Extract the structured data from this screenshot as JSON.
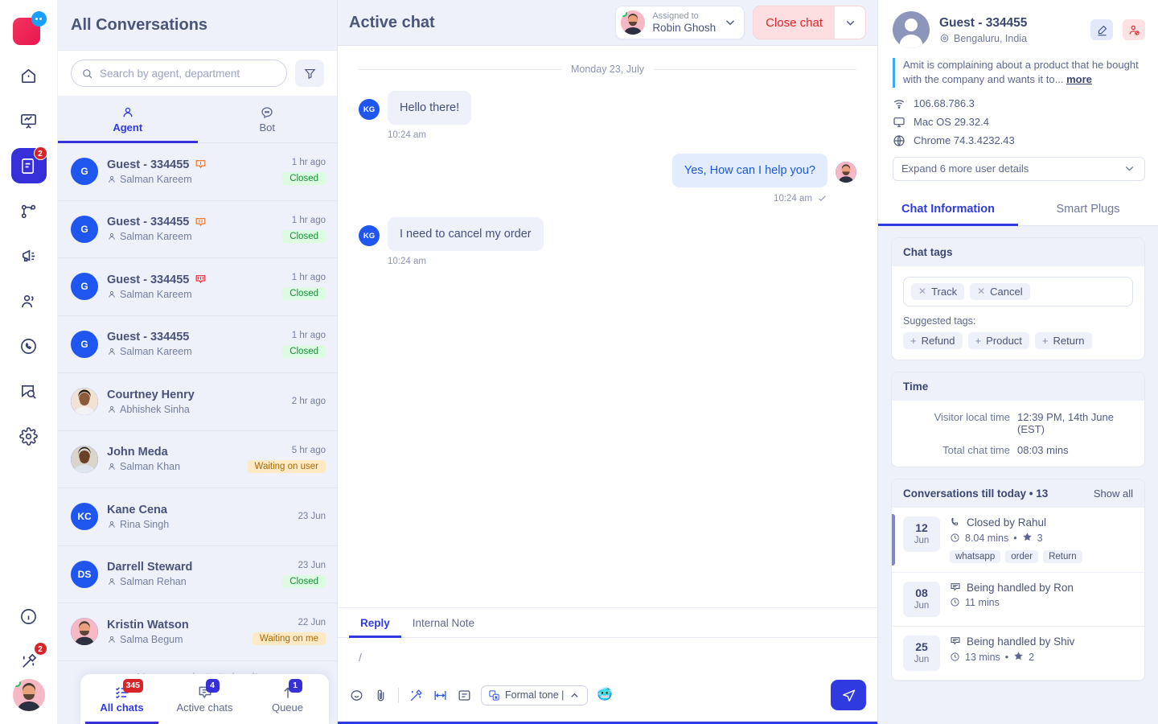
{
  "rail": {
    "logo": "brand-logo",
    "items": [
      {
        "name": "home-icon",
        "badge": null
      },
      {
        "name": "analytics-icon",
        "badge": null
      },
      {
        "name": "conversations-icon",
        "badge": "2",
        "active": true
      },
      {
        "name": "flows-icon",
        "badge": null
      },
      {
        "name": "campaigns-icon",
        "badge": null
      },
      {
        "name": "contacts-icon",
        "badge": null
      },
      {
        "name": "whatsapp-icon",
        "badge": null
      },
      {
        "name": "search-chat-icon",
        "badge": null
      },
      {
        "name": "settings-icon",
        "badge": null
      },
      {
        "name": "info-icon",
        "badge": null
      },
      {
        "name": "magic-icon",
        "badge": "2"
      }
    ]
  },
  "list": {
    "title": "All Conversations",
    "search_placeholder": "Search by agent, department",
    "search_value": "",
    "filter_label": "filter-icon",
    "tabs": [
      {
        "label": "Agent",
        "icon": "agent-icon",
        "active": true
      },
      {
        "label": "Bot",
        "icon": "bot-icon",
        "active": false
      }
    ],
    "no_more_text": "No more chats to load!",
    "conversations": [
      {
        "name": "Guest - 334455",
        "agent": "Salman Kareem",
        "time": "1 hr ago",
        "status": "Closed",
        "status_kind": "closed",
        "avatar": "G",
        "avatar_kind": "initial",
        "priority": 1
      },
      {
        "name": "Guest - 334455",
        "agent": "Salman Kareem",
        "time": "1 hr ago",
        "status": "Closed",
        "status_kind": "closed",
        "avatar": "G",
        "avatar_kind": "initial",
        "priority": 2
      },
      {
        "name": "Guest - 334455",
        "agent": "Salman Kareem",
        "time": "1 hr ago",
        "status": "Closed",
        "status_kind": "closed",
        "avatar": "G",
        "avatar_kind": "initial",
        "priority": 3
      },
      {
        "name": "Guest - 334455",
        "agent": "Salman Kareem",
        "time": "1 hr ago",
        "status": "Closed",
        "status_kind": "closed",
        "avatar": "G",
        "avatar_kind": "initial",
        "priority": 0
      },
      {
        "name": "Courtney Henry",
        "agent": "Abhishek Sinha",
        "time": "2 hr ago",
        "status": "",
        "status_kind": "none",
        "avatar": "",
        "avatar_kind": "photo-a",
        "priority": 0
      },
      {
        "name": "John Meda",
        "agent": "Salman Khan",
        "time": "5 hr ago",
        "status": "Waiting on user",
        "status_kind": "waituser",
        "avatar": "",
        "avatar_kind": "photo-b",
        "priority": 0
      },
      {
        "name": "Kane Cena",
        "agent": "Rina Singh",
        "time": "23 Jun",
        "status": "",
        "status_kind": "none",
        "avatar": "KC",
        "avatar_kind": "initial",
        "priority": 0
      },
      {
        "name": "Darrell Steward",
        "agent": "Salman Rehan",
        "time": "23 Jun",
        "status": "Closed",
        "status_kind": "closed",
        "avatar": "DS",
        "avatar_kind": "initial",
        "priority": 0
      },
      {
        "name": "Kristin Watson",
        "agent": "Salma Begum",
        "time": "22 Jun",
        "status": "Waiting on me",
        "status_kind": "waitme",
        "avatar": "",
        "avatar_kind": "photo-c",
        "priority": 0
      }
    ],
    "bottom_nav": [
      {
        "label": "All chats",
        "badge": "345",
        "badge_color": "red",
        "icon": "all-chats-icon",
        "active": true
      },
      {
        "label": "Active chats",
        "badge": "4",
        "badge_color": "blue",
        "icon": "active-chats-icon",
        "active": false
      },
      {
        "label": "Queue",
        "badge": "1",
        "badge_color": "blue",
        "icon": "queue-arrow-icon",
        "active": false
      }
    ]
  },
  "chat": {
    "title": "Active chat",
    "assigned_label": "Assigned to",
    "assigned_name": "Robin Ghosh",
    "close_button": "Close chat",
    "date_separator": "Monday 23, July",
    "messages": [
      {
        "dir": "in",
        "avatar": "KG",
        "text": "Hello there!",
        "time": "10:24 am",
        "read": false
      },
      {
        "dir": "out",
        "avatar": "",
        "text": "Yes, How can I help you?",
        "time": "10:24 am",
        "read": true
      },
      {
        "dir": "in",
        "avatar": "KG",
        "text": "I need to cancel my order",
        "time": "10:24 am",
        "read": false
      }
    ],
    "composer": {
      "tabs": [
        {
          "label": "Reply",
          "active": true
        },
        {
          "label": "Internal Note",
          "active": false
        }
      ],
      "value": "/",
      "tools": [
        {
          "name": "emoji-icon"
        },
        {
          "name": "attachment-icon"
        },
        {
          "name": "magic-wand-icon"
        },
        {
          "name": "expand-width-icon"
        },
        {
          "name": "canned-response-icon"
        }
      ],
      "tone_label": "Formal tone |",
      "tone_emoji": "🥶",
      "send_label": "send-icon"
    }
  },
  "panel": {
    "user": {
      "name": "Guest - 334455",
      "location": "Bengaluru, India",
      "note": "Amit is complaining about a product that he bought with the company and wants it to...",
      "note_more": "more",
      "meta": [
        {
          "icon": "wifi-icon",
          "value": "106.68.786.3"
        },
        {
          "icon": "desktop-icon",
          "value": "Mac OS 29.32.4"
        },
        {
          "icon": "globe-icon",
          "value": "Chrome 74.3.4232.43"
        }
      ],
      "expand_label": "Expand 6 more user details",
      "edit_icon": "edit-pencil-icon",
      "block_icon": "block-user-icon"
    },
    "tabs": [
      {
        "label": "Chat Information",
        "active": true
      },
      {
        "label": "Smart Plugs",
        "active": false
      }
    ],
    "chat_tags": {
      "title": "Chat tags",
      "tags": [
        "Track",
        "Cancel"
      ],
      "suggested_label": "Suggested tags:",
      "suggested": [
        "Refund",
        "Product",
        "Return"
      ]
    },
    "time": {
      "title": "Time",
      "rows": [
        {
          "label": "Visitor local time",
          "value": "12:39 PM, 14th June (EST)"
        },
        {
          "label": "Total chat time",
          "value": "08:03 mins"
        }
      ]
    },
    "history": {
      "title": "Conversations till today • 13",
      "show_all": "Show all",
      "items": [
        {
          "day": "12",
          "month": "Jun",
          "title": "Closed by Rahul",
          "title_icon": "phone-icon",
          "duration": "8.04 mins",
          "rating": "3",
          "tags": [
            "whatsapp",
            "order",
            "Return"
          ],
          "active": true
        },
        {
          "day": "08",
          "month": "Jun",
          "title": "Being handled by Ron",
          "title_icon": "chat-icon",
          "duration": "11 mins",
          "rating": "",
          "tags": [],
          "active": false
        },
        {
          "day": "25",
          "month": "Jun",
          "title": "Being handled by Shiv",
          "title_icon": "chat-icon",
          "duration": "13 mins",
          "rating": "2",
          "tags": [],
          "active": false
        }
      ]
    }
  },
  "colors": {
    "brand_blue": "#3730d8",
    "accent_blue": "#2f3be0",
    "danger_red": "#e0242c",
    "success_green": "#1a8c3c",
    "warn_amber": "#a8690a",
    "panel_bg": "#eef1fa"
  }
}
